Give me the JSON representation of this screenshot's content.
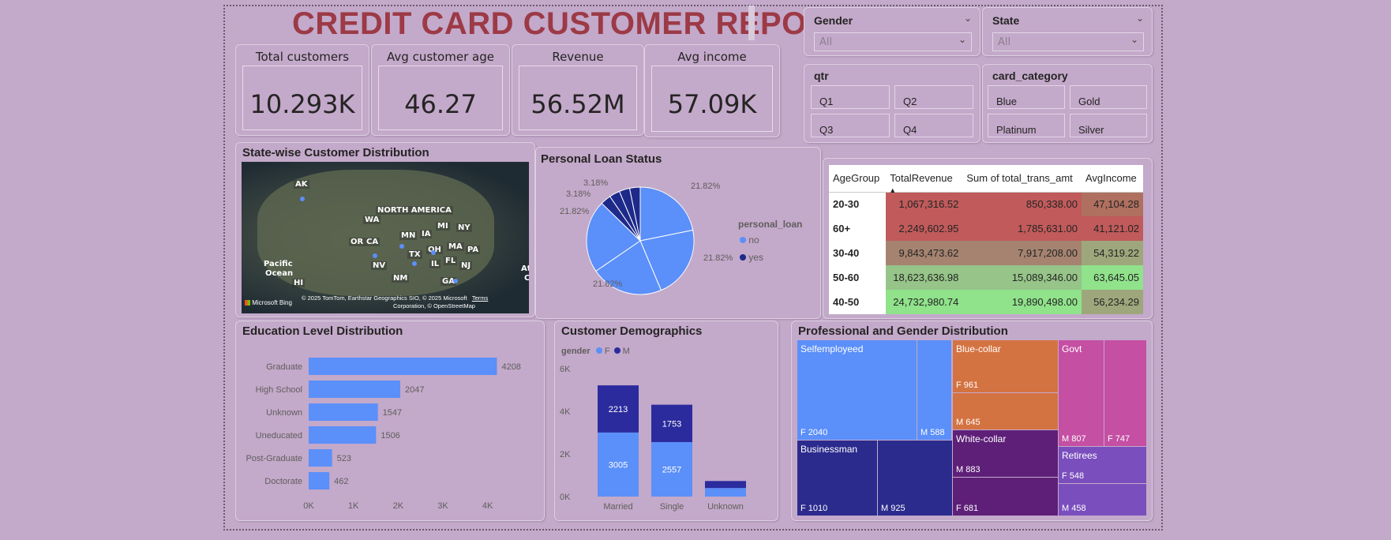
{
  "report": {
    "title": "CREDIT CARD CUSTOMER REPORT"
  },
  "kpis": [
    {
      "label": "Total customers",
      "value": "10.293K"
    },
    {
      "label": "Avg customer age",
      "value": "46.27"
    },
    {
      "label": "Revenue",
      "value": "56.52M"
    },
    {
      "label": "Avg income",
      "value": "57.09K"
    }
  ],
  "slicers": {
    "gender": {
      "title": "Gender",
      "selected": "All"
    },
    "state": {
      "title": "State",
      "selected": "All"
    },
    "qtr": {
      "title": "qtr",
      "options": [
        "Q1",
        "Q2",
        "Q3",
        "Q4"
      ]
    },
    "card_category": {
      "title": "card_category",
      "options": [
        "Blue",
        "Gold",
        "Platinum",
        "Silver"
      ]
    }
  },
  "map": {
    "title": "State-wise Customer Distribution",
    "labels": [
      "AK",
      "NORTH AMERICA",
      "WA",
      "MI",
      "NY",
      "OR",
      "CA",
      "MN",
      "IA",
      "OH",
      "MA",
      "PA",
      "TX",
      "IL",
      "FL",
      "NJ",
      "NV",
      "NM",
      "GA",
      "HI",
      "Pacific",
      "Ocean",
      "At",
      "C"
    ],
    "bing": "Microsoft Bing",
    "copyright_line1": "© 2025 TomTom, Earthstar Geographics SIO, © 2025 Microsoft",
    "terms": "Terms",
    "copyright_line2": "Corporation, © OpenStreetMap"
  },
  "loan": {
    "title": "Personal Loan Status",
    "legend_title": "personal_loan",
    "legend": [
      {
        "name": "no",
        "color": "#5b8ff9"
      },
      {
        "name": "yes",
        "color": "#1e2a8a"
      }
    ],
    "labels": [
      "21.82%",
      "21.82%",
      "21.82%",
      "21.82%",
      "3.18%",
      "3.18%"
    ]
  },
  "matrix": {
    "headers": [
      "AgeGroup",
      "TotalRevenue",
      "Sum of total_trans_amt",
      "AvgIncome"
    ],
    "sort_indicator": "▲",
    "rows": [
      {
        "group": "20-30",
        "rev": "1,067,316.52",
        "trans": "850,338.00",
        "inc": "47,104.28"
      },
      {
        "group": "60+",
        "rev": "2,249,602.95",
        "trans": "1,785,631.00",
        "inc": "41,121.02"
      },
      {
        "group": "30-40",
        "rev": "9,843,473.62",
        "trans": "7,917,208.00",
        "inc": "54,319.22"
      },
      {
        "group": "50-60",
        "rev": "18,623,636.98",
        "trans": "15,089,346.00",
        "inc": "63,645.05"
      },
      {
        "group": "40-50",
        "rev": "24,732,980.74",
        "trans": "19,890,498.00",
        "inc": "56,234.29"
      }
    ],
    "colors": {
      "rev": [
        "#c05a5b",
        "#c05a5b",
        "#a58370",
        "#96c489",
        "#90e28b"
      ],
      "trans": [
        "#c05a5b",
        "#c05a5b",
        "#a58370",
        "#96c489",
        "#90e28b"
      ],
      "inc": [
        "#b0705f",
        "#c05a5b",
        "#9ea77c",
        "#90e28b",
        "#9ea77c"
      ]
    }
  },
  "education": {
    "title": "Education Level Distribution"
  },
  "demographics": {
    "title": "Customer Demographics",
    "legend_title": "gender",
    "legend": [
      {
        "name": "F",
        "color": "#5b8ff9"
      },
      {
        "name": "M",
        "color": "#2b2b9e"
      }
    ]
  },
  "treemap": {
    "title": "Professional and Gender Distribution",
    "groups": [
      "Selfemployeed",
      "Blue-collar",
      "Govt",
      "Businessman",
      "White-collar",
      "Retirees"
    ],
    "cells": [
      "F 2040",
      "M 588",
      "F 961",
      "M 645",
      "M 807",
      "F 747",
      "F 1010",
      "M 925",
      "M 883",
      "F 681",
      "F 548",
      "M 458"
    ]
  },
  "chart_data": [
    {
      "type": "bar",
      "title": "Education Level Distribution",
      "orientation": "horizontal",
      "categories": [
        "Graduate",
        "High School",
        "Unknown",
        "Uneducated",
        "Post-Graduate",
        "Doctorate"
      ],
      "values": [
        4208,
        2047,
        1547,
        1506,
        523,
        462
      ],
      "xlim": [
        0,
        4200
      ],
      "xticks": [
        "0K",
        "1K",
        "2K",
        "3K",
        "4K"
      ],
      "color": "#5b8ff9"
    },
    {
      "type": "bar",
      "stacked": true,
      "title": "Customer Demographics",
      "categories": [
        "Married",
        "Single",
        "Unknown"
      ],
      "series": [
        {
          "name": "F",
          "values": [
            3005,
            2557,
            400
          ],
          "color": "#5b8ff9"
        },
        {
          "name": "M",
          "values": [
            2213,
            1753,
            330
          ],
          "color": "#2b2b9e"
        }
      ],
      "ylim": [
        0,
        6000
      ],
      "yticks": [
        "0K",
        "2K",
        "4K",
        "6K"
      ],
      "data_labels": [
        "3005",
        "2213",
        "2557",
        "1753"
      ]
    },
    {
      "type": "pie",
      "title": "Personal Loan Status",
      "slices": [
        {
          "name": "no",
          "value": 21.82
        },
        {
          "name": "no",
          "value": 21.82
        },
        {
          "name": "no",
          "value": 21.82
        },
        {
          "name": "no",
          "value": 21.82
        },
        {
          "name": "yes",
          "value": 3.18
        },
        {
          "name": "yes",
          "value": 3.18
        },
        {
          "name": "yes",
          "value": 3.18
        },
        {
          "name": "yes",
          "value": 3.18
        }
      ]
    }
  ]
}
